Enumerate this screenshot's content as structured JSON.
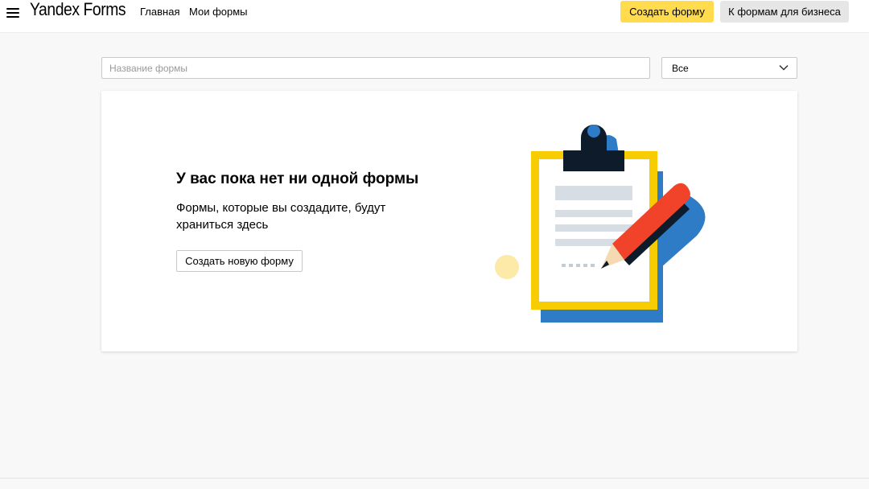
{
  "header": {
    "logo_text": "Yandex Forms",
    "nav": [
      {
        "label": "Главная"
      },
      {
        "label": "Мои формы"
      }
    ],
    "create_form_label": "Создать форму",
    "business_label": "К формам для бизнеса"
  },
  "filters": {
    "search_placeholder": "Название формы",
    "search_value": "",
    "select_value": "Все"
  },
  "empty_state": {
    "title": "У вас пока нет ни одной формы",
    "text": "Формы, которые вы создадите, будут храниться здесь",
    "button_label": "Создать новую форму"
  },
  "colors": {
    "accent_yellow": "#ffdb4d",
    "clipboard_yellow": "#f7cc00",
    "blue": "#2e7bc6",
    "pencil_red": "#f0432a",
    "dark": "#0d1b2a"
  },
  "icons": {
    "menu": "hamburger-icon",
    "select": "chevron-down-icon",
    "illustration": "clipboard-pencil-illustration"
  }
}
